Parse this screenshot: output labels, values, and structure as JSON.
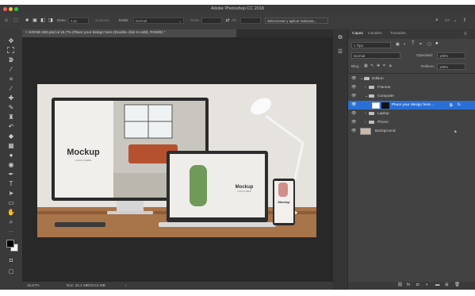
{
  "window": {
    "title": "Adobe Photoshop CC 2018",
    "traffic_lights": [
      "#ff5f57",
      "#febc2e",
      "#28c840"
    ]
  },
  "options_bar": {
    "home_icon": "home-icon",
    "move_icon": "move-tool-icon",
    "feather_label": "Desv.:",
    "feather_value": "0 px",
    "antialias": "Suavizar",
    "style_label": "Estilo:",
    "style_value": "Normal",
    "width_label": "Anch.:",
    "height_label": "Alt.:",
    "mask_button": "Seleccionar y aplicar máscara...",
    "search_icon": "search-icon"
  },
  "document_tab": {
    "label": "SIGNE-360.psd al 16,7% (Place your design here (Double click to edit), RGB/8) *"
  },
  "canvas": {
    "desktop_title": "Mockup",
    "desktop_subtitle": "LOGO & HERE",
    "laptop_title": "Mockup",
    "laptop_subtitle": "LOGO & HERE",
    "phone_title": "Mockup"
  },
  "status": {
    "zoom": "16,67%",
    "doc": "Doc: 32,1 MB/313,5 MB"
  },
  "layers_panel": {
    "tabs": [
      "Capas",
      "Canales",
      "Trazados"
    ],
    "kind_label": "Tipo",
    "blend_mode": "Normal",
    "opacity_label": "Opacidad:",
    "opacity_value": "100%",
    "lock_label": "Bloq.:",
    "fill_label": "Relleno:",
    "fill_value": "100%",
    "layers": [
      {
        "name": "Edition",
        "type": "group",
        "indent": 0,
        "open": true,
        "selected": false
      },
      {
        "name": "Frames",
        "type": "group",
        "indent": 1,
        "open": false,
        "selected": false
      },
      {
        "name": "Computer",
        "type": "group",
        "indent": 1,
        "open": true,
        "selected": false
      },
      {
        "name": "Place your design here ...",
        "type": "smart",
        "indent": 2,
        "open": false,
        "selected": true
      },
      {
        "name": "Laptop",
        "type": "group",
        "indent": 1,
        "open": false,
        "selected": false
      },
      {
        "name": "Phone",
        "type": "group",
        "indent": 1,
        "open": false,
        "selected": false
      },
      {
        "name": "Background",
        "type": "image",
        "indent": 0,
        "open": false,
        "selected": false
      }
    ]
  }
}
